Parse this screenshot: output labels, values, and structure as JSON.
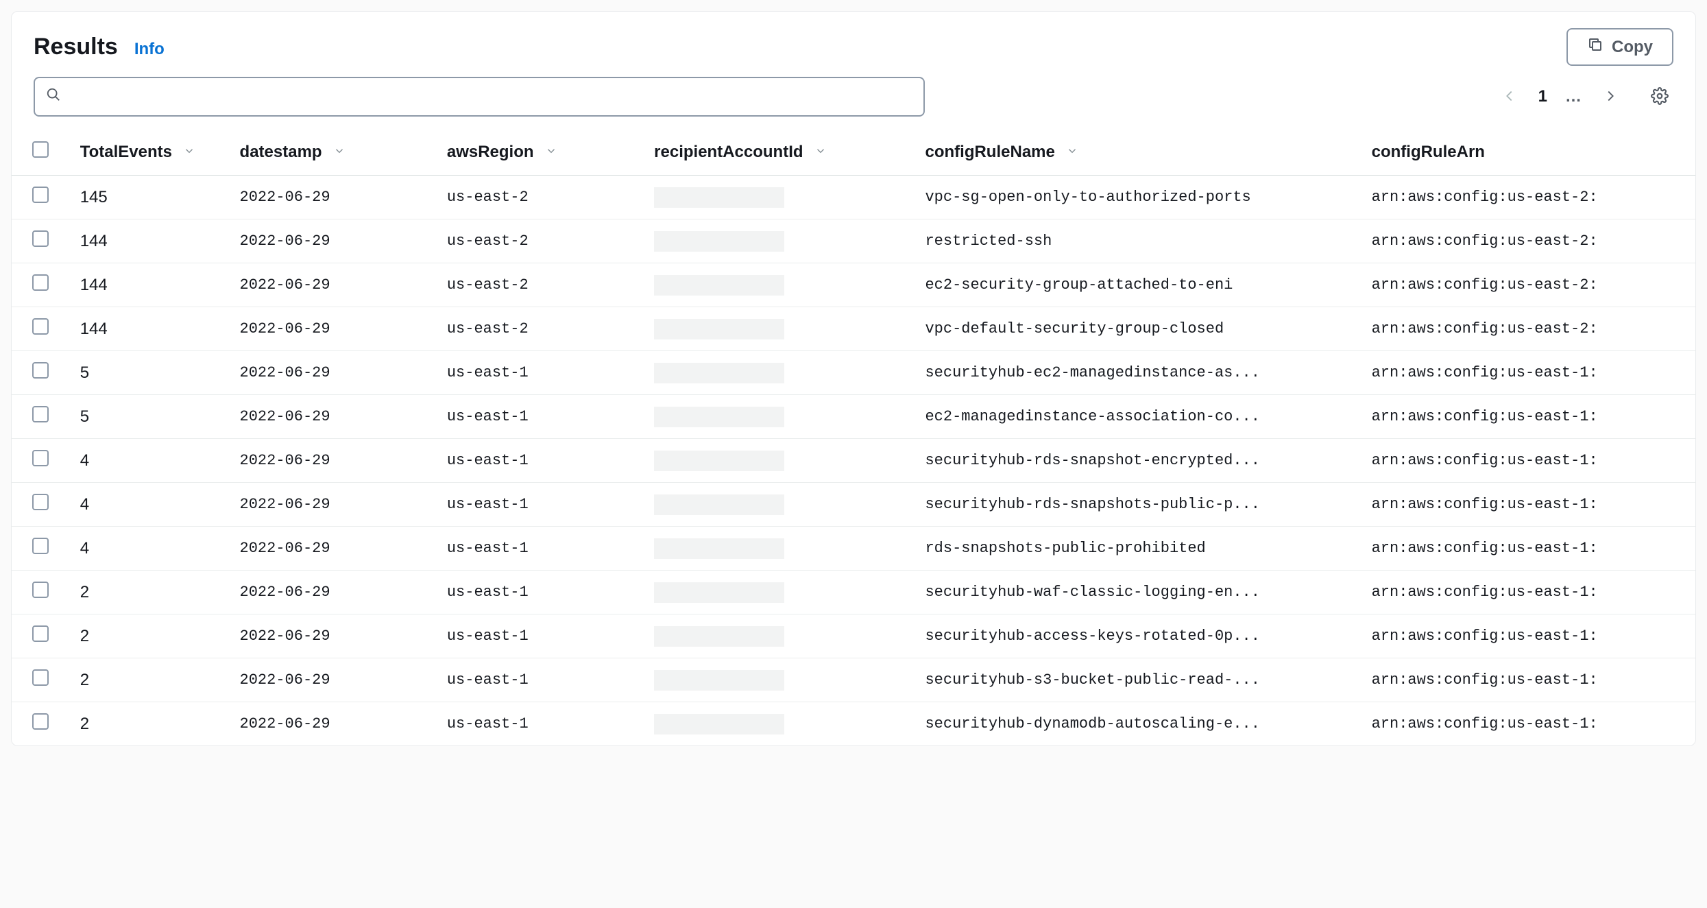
{
  "header": {
    "title": "Results",
    "info_label": "Info",
    "copy_label": "Copy"
  },
  "search": {
    "placeholder": ""
  },
  "pagination": {
    "current": "1",
    "ellipsis": "…"
  },
  "columns": {
    "totalEvents": "TotalEvents",
    "datestamp": "datestamp",
    "awsRegion": "awsRegion",
    "recipientAccountId": "recipientAccountId",
    "configRuleName": "configRuleName",
    "configRuleArn": "configRuleArn"
  },
  "rows": [
    {
      "totalEvents": "145",
      "datestamp": "2022-06-29",
      "awsRegion": "us-east-2",
      "recipientAccountId": "",
      "configRuleName": "vpc-sg-open-only-to-authorized-ports",
      "configRuleArn": "arn:aws:config:us-east-2:"
    },
    {
      "totalEvents": "144",
      "datestamp": "2022-06-29",
      "awsRegion": "us-east-2",
      "recipientAccountId": "",
      "configRuleName": "restricted-ssh",
      "configRuleArn": "arn:aws:config:us-east-2:"
    },
    {
      "totalEvents": "144",
      "datestamp": "2022-06-29",
      "awsRegion": "us-east-2",
      "recipientAccountId": "",
      "configRuleName": "ec2-security-group-attached-to-eni",
      "configRuleArn": "arn:aws:config:us-east-2:"
    },
    {
      "totalEvents": "144",
      "datestamp": "2022-06-29",
      "awsRegion": "us-east-2",
      "recipientAccountId": "",
      "configRuleName": "vpc-default-security-group-closed",
      "configRuleArn": "arn:aws:config:us-east-2:"
    },
    {
      "totalEvents": "5",
      "datestamp": "2022-06-29",
      "awsRegion": "us-east-1",
      "recipientAccountId": "",
      "configRuleName": "securityhub-ec2-managedinstance-as...",
      "configRuleArn": "arn:aws:config:us-east-1:"
    },
    {
      "totalEvents": "5",
      "datestamp": "2022-06-29",
      "awsRegion": "us-east-1",
      "recipientAccountId": "",
      "configRuleName": "ec2-managedinstance-association-co...",
      "configRuleArn": "arn:aws:config:us-east-1:"
    },
    {
      "totalEvents": "4",
      "datestamp": "2022-06-29",
      "awsRegion": "us-east-1",
      "recipientAccountId": "",
      "configRuleName": "securityhub-rds-snapshot-encrypted...",
      "configRuleArn": "arn:aws:config:us-east-1:"
    },
    {
      "totalEvents": "4",
      "datestamp": "2022-06-29",
      "awsRegion": "us-east-1",
      "recipientAccountId": "",
      "configRuleName": "securityhub-rds-snapshots-public-p...",
      "configRuleArn": "arn:aws:config:us-east-1:"
    },
    {
      "totalEvents": "4",
      "datestamp": "2022-06-29",
      "awsRegion": "us-east-1",
      "recipientAccountId": "",
      "configRuleName": "rds-snapshots-public-prohibited",
      "configRuleArn": "arn:aws:config:us-east-1:"
    },
    {
      "totalEvents": "2",
      "datestamp": "2022-06-29",
      "awsRegion": "us-east-1",
      "recipientAccountId": "",
      "configRuleName": "securityhub-waf-classic-logging-en...",
      "configRuleArn": "arn:aws:config:us-east-1:"
    },
    {
      "totalEvents": "2",
      "datestamp": "2022-06-29",
      "awsRegion": "us-east-1",
      "recipientAccountId": "",
      "configRuleName": "securityhub-access-keys-rotated-0p...",
      "configRuleArn": "arn:aws:config:us-east-1:"
    },
    {
      "totalEvents": "2",
      "datestamp": "2022-06-29",
      "awsRegion": "us-east-1",
      "recipientAccountId": "",
      "configRuleName": "securityhub-s3-bucket-public-read-...",
      "configRuleArn": "arn:aws:config:us-east-1:"
    },
    {
      "totalEvents": "2",
      "datestamp": "2022-06-29",
      "awsRegion": "us-east-1",
      "recipientAccountId": "",
      "configRuleName": "securityhub-dynamodb-autoscaling-e...",
      "configRuleArn": "arn:aws:config:us-east-1:"
    }
  ]
}
